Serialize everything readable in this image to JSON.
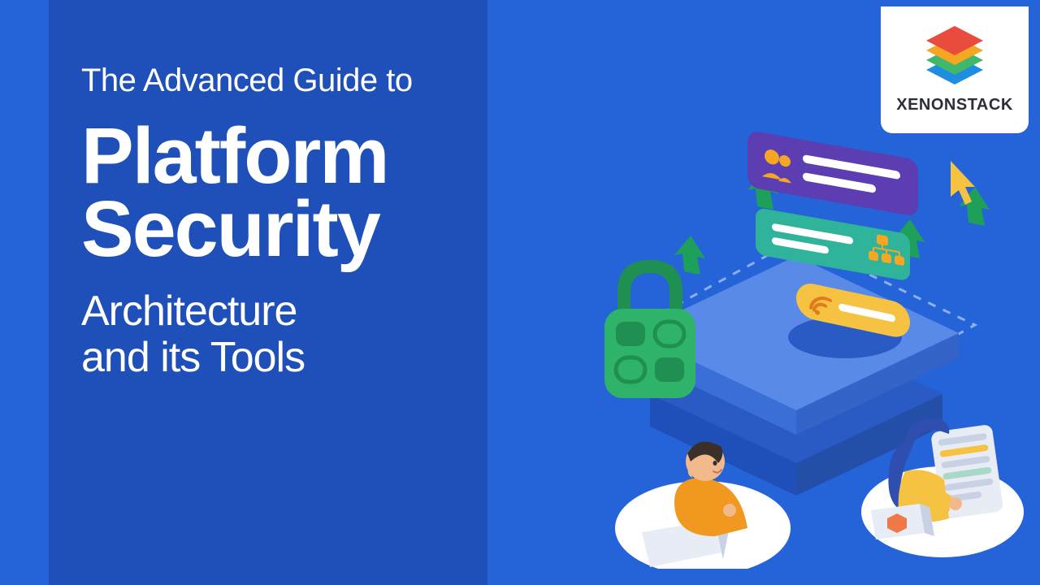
{
  "hero": {
    "pretitle": "The Advanced Guide to",
    "title_line1": "Platform",
    "title_line2": "Security",
    "subtitle_line1": "Architecture",
    "subtitle_line2": "and its Tools"
  },
  "brand": {
    "name": "XENONSTACK"
  },
  "colors": {
    "bg": "#2563d9",
    "panel": "#1f4fb8",
    "logo_red": "#e94b3c",
    "logo_orange": "#f5a623",
    "logo_green": "#3fb86b",
    "logo_blue": "#1f8de0",
    "card_purple": "#5c3db2",
    "card_teal": "#2fb39a",
    "card_yellow": "#f5c242",
    "lock_green": "#2fb36b",
    "lock_dark": "#1f8f52",
    "platform_mid": "#3a6fd8",
    "platform_dark": "#2a5bc4",
    "platform_light": "#5a8ae8"
  },
  "icons": {
    "lock": "lock-icon",
    "users": "users-icon",
    "org": "org-chart-icon",
    "wifi": "wifi-icon",
    "arrow": "arrow-up-icon",
    "cursor": "cursor-icon"
  }
}
